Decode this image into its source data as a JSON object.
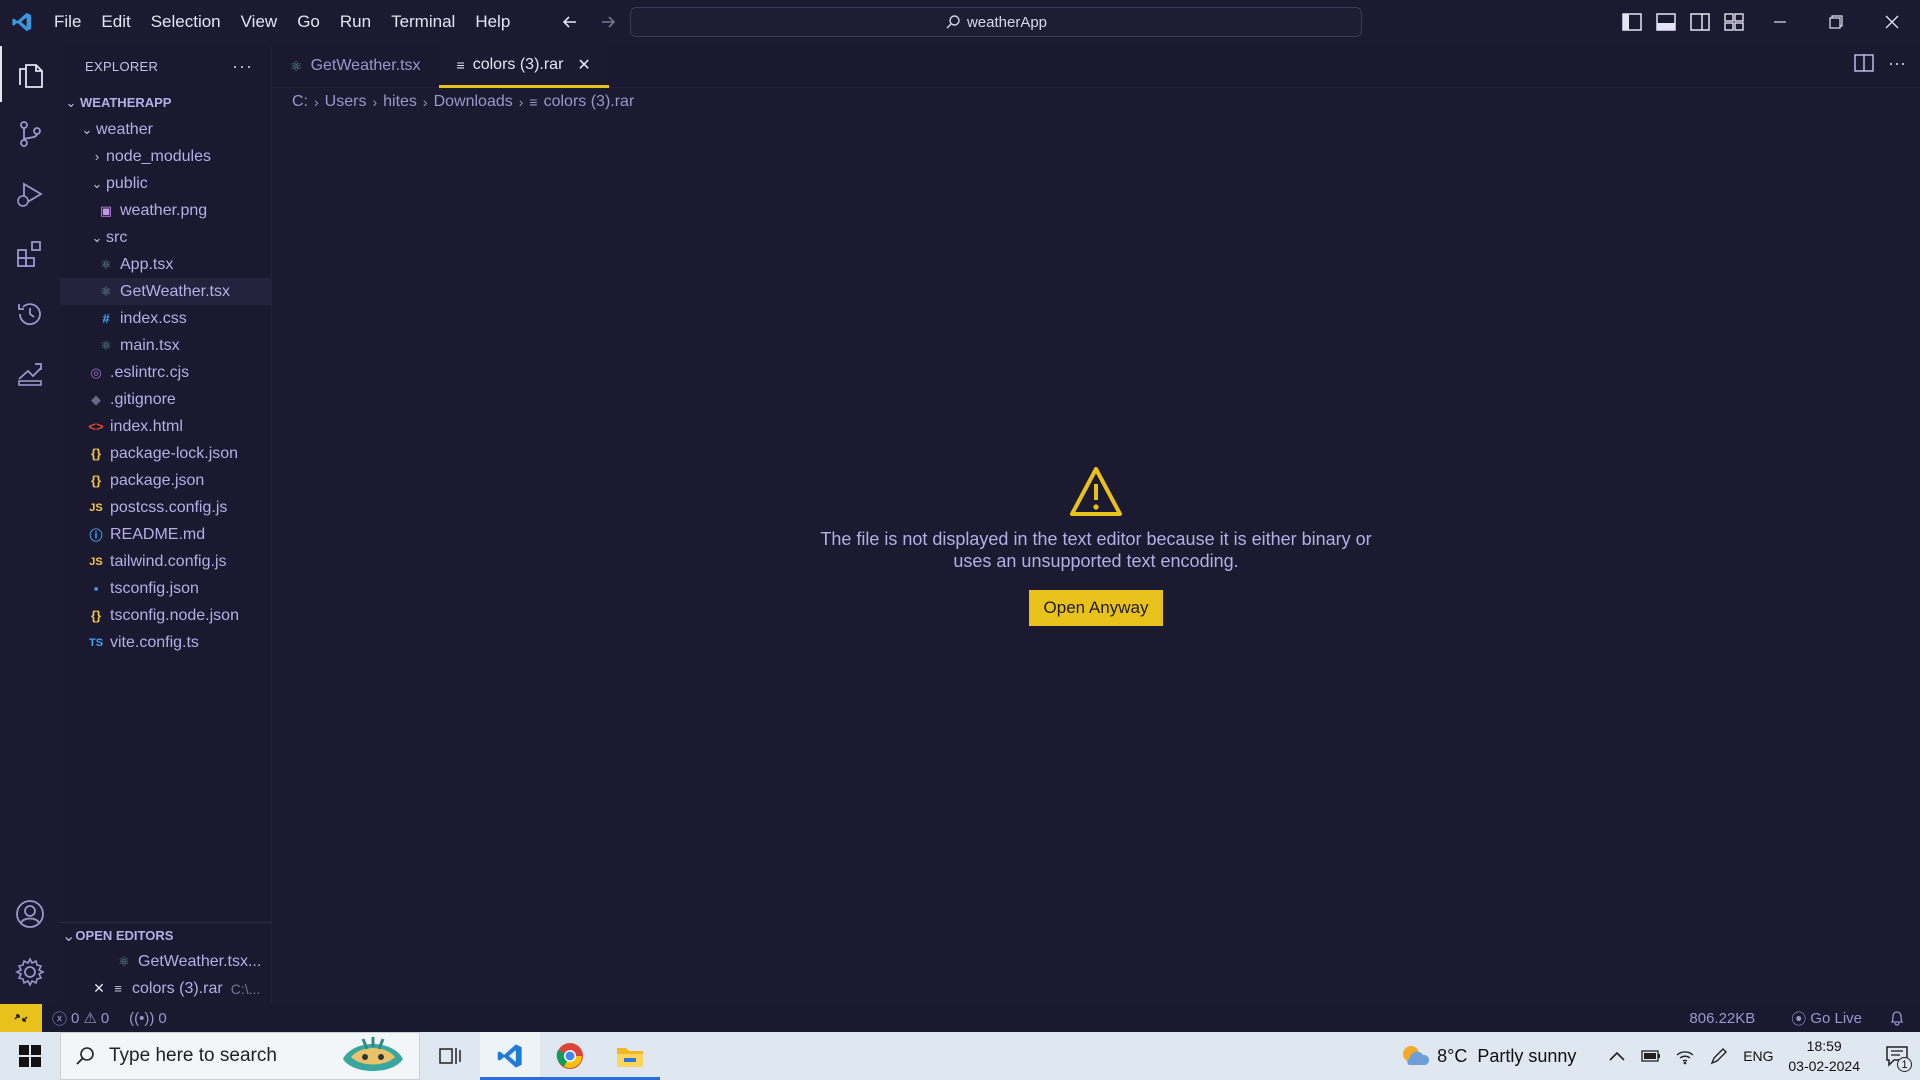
{
  "menu": [
    "File",
    "Edit",
    "Selection",
    "View",
    "Go",
    "Run",
    "Terminal",
    "Help"
  ],
  "command_center": {
    "label": "weatherApp"
  },
  "colors": {
    "accent": "#e8c21a",
    "background": "#1c1a30",
    "text": "#b7aee6"
  },
  "sidebar": {
    "header": "EXPLORER",
    "project": "WEATHERAPP",
    "tree": [
      {
        "label": "weather",
        "type": "folder-open",
        "depth": 0
      },
      {
        "label": "node_modules",
        "type": "folder-closed",
        "depth": 1
      },
      {
        "label": "public",
        "type": "folder-open",
        "depth": 1
      },
      {
        "label": "weather.png",
        "type": "image",
        "depth": 2
      },
      {
        "label": "src",
        "type": "folder-open",
        "depth": 1
      },
      {
        "label": "App.tsx",
        "type": "react",
        "depth": 2
      },
      {
        "label": "GetWeather.tsx",
        "type": "react",
        "depth": 2,
        "selected": true
      },
      {
        "label": "index.css",
        "type": "css",
        "depth": 2
      },
      {
        "label": "main.tsx",
        "type": "react",
        "depth": 2
      },
      {
        "label": ".eslintrc.cjs",
        "type": "eslint",
        "depth": 1
      },
      {
        "label": ".gitignore",
        "type": "git",
        "depth": 1
      },
      {
        "label": "index.html",
        "type": "html",
        "depth": 1
      },
      {
        "label": "package-lock.json",
        "type": "json",
        "depth": 1
      },
      {
        "label": "package.json",
        "type": "json",
        "depth": 1
      },
      {
        "label": "postcss.config.js",
        "type": "js",
        "depth": 1
      },
      {
        "label": "README.md",
        "type": "info",
        "depth": 1
      },
      {
        "label": "tailwind.config.js",
        "type": "js",
        "depth": 1
      },
      {
        "label": "tsconfig.json",
        "type": "tsconfig",
        "depth": 1
      },
      {
        "label": "tsconfig.node.json",
        "type": "json",
        "depth": 1
      },
      {
        "label": "vite.config.ts",
        "type": "ts",
        "depth": 1
      }
    ],
    "open_editors": {
      "title": "OPEN EDITORS",
      "items": [
        {
          "label": "GetWeather.tsx...",
          "path": ""
        },
        {
          "label": "colors (3).rar",
          "path": "C:\\..."
        }
      ]
    }
  },
  "tabs": [
    {
      "label": "GetWeather.tsx",
      "active": false
    },
    {
      "label": "colors (3).rar",
      "active": true
    }
  ],
  "breadcrumb": [
    "C:",
    "Users",
    "hites",
    "Downloads",
    "colors (3).rar"
  ],
  "editor": {
    "message_line1": "The file is not displayed in the text editor because it is either binary or",
    "message_line2": "uses an unsupported text encoding.",
    "button": "Open Anyway"
  },
  "statusbar": {
    "errors": "0",
    "warnings": "0",
    "ports": "0",
    "file_size": "806.22KB",
    "go_live": "Go Live"
  },
  "taskbar": {
    "search_placeholder": "Type here to search",
    "weather": "8°C  Partly sunny",
    "language": "ENG",
    "time": "18:59",
    "date": "03-02-2024",
    "notification_count": "1"
  }
}
